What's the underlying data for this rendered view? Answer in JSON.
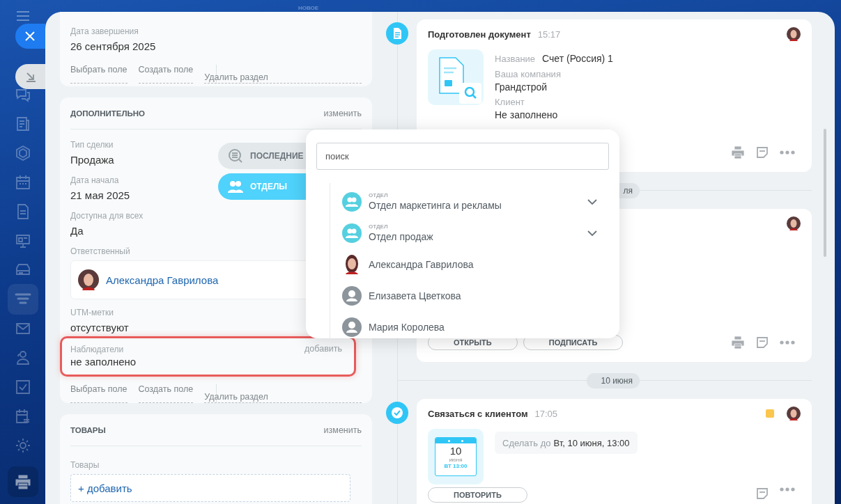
{
  "top_label": "НОВОЕ",
  "end_card": {
    "fields": [
      {
        "label": "Дата завершения",
        "value": "26 сентября 2025"
      }
    ],
    "links": [
      "Выбрать поле",
      "Создать поле"
    ],
    "delete_link": "Удалить раздел"
  },
  "extra_card": {
    "title": "ДОПОЛНИТЕЛЬНО",
    "action": "изменить",
    "fields": [
      {
        "kind": "text",
        "label": "Тип сделки",
        "value": "Продажа"
      },
      {
        "kind": "text",
        "label": "Дата начала",
        "value": "21 мая 2025"
      },
      {
        "kind": "text",
        "label": "Доступна для всех",
        "value": "Да"
      },
      {
        "kind": "person",
        "label": "Ответственный",
        "value": "Александра Гаврилова"
      },
      {
        "kind": "text",
        "label": "UTM-метки",
        "value": "отсутствуют"
      },
      {
        "kind": "highlight",
        "label": "Наблюдатели",
        "value": "не заполнено",
        "action": "добавить"
      }
    ],
    "links": [
      "Выбрать поле",
      "Создать поле"
    ],
    "delete_link": "Удалить раздел"
  },
  "goods_card": {
    "title": "ТОВАРЫ",
    "action": "изменить",
    "label": "Товары",
    "add_button": "+ добавить"
  },
  "timeline": [
    {
      "kind": "document",
      "title": "Подготовлен документ",
      "time": "15:17",
      "props": [
        {
          "label": "Название",
          "value": "Счет (Россия) 1"
        },
        {
          "label": "Ваша компания",
          "value": "Грандстрой"
        },
        {
          "label": "Клиент",
          "value": "Не заполнено"
        }
      ]
    },
    {
      "kind": "date",
      "label": "ля"
    },
    {
      "kind": "covered",
      "buttons": [
        "ОТКРЫТЬ",
        "ПОДПИСАТЬ"
      ]
    },
    {
      "kind": "date",
      "label": "10 июня"
    },
    {
      "kind": "task",
      "title": "Связаться с клиентом",
      "time": "17:05",
      "color": "#fbc64d",
      "calendar": {
        "day": "10",
        "month": "июня",
        "sub": "ВТ 13:00"
      },
      "deadline": {
        "label": "Сделать до",
        "value": "Вт, 10 июня, 13:00"
      },
      "buttons": [
        "ПОВТОРИТЬ"
      ]
    }
  ],
  "picker": {
    "tabs": [
      {
        "label": "ПОСЛЕДНИЕ",
        "selected": false
      },
      {
        "label": "ОТДЕЛЫ",
        "selected": true
      }
    ],
    "search": {
      "placeholder": "поиск"
    },
    "items": [
      {
        "kind": "department",
        "caption": "ОТДЕЛ",
        "name": "Отдел маркетинга и рекламы"
      },
      {
        "kind": "department",
        "caption": "ОТДЕЛ",
        "name": "Отдел продаж"
      },
      {
        "kind": "photo",
        "name": "Александра Гаврилова"
      },
      {
        "kind": "user",
        "name": "Елизавета Цветкова"
      },
      {
        "kind": "user",
        "name": "Мария Королева"
      }
    ]
  }
}
